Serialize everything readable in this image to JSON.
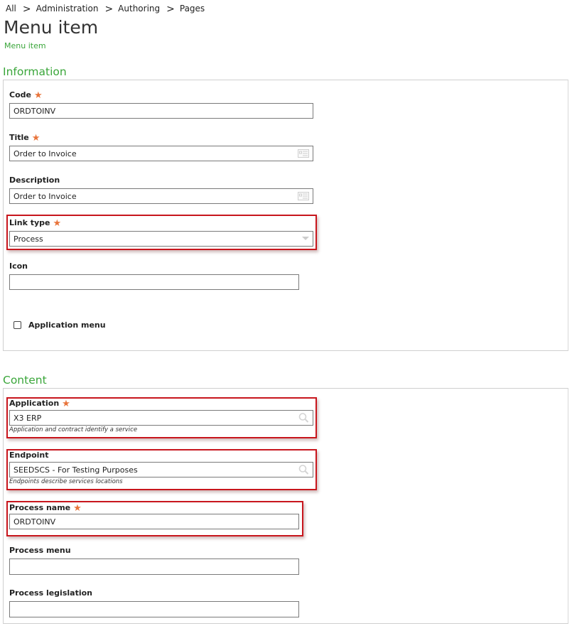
{
  "breadcrumb": {
    "items": [
      "All",
      "Administration",
      "Authoring",
      "Pages"
    ],
    "separator": ">"
  },
  "page": {
    "title": "Menu item",
    "subtitle": "Menu item"
  },
  "colors": {
    "accent_green": "#3aa63a",
    "required_star": "#e8743b",
    "highlight_red": "#c8161d"
  },
  "sections": {
    "information": {
      "title": "Information",
      "fields": {
        "code": {
          "label": "Code",
          "required": true,
          "value": "ORDTOINV"
        },
        "title": {
          "label": "Title",
          "required": true,
          "value": "Order to Invoice",
          "icon": "translate-icon"
        },
        "description": {
          "label": "Description",
          "required": false,
          "value": "Order to Invoice",
          "icon": "translate-icon"
        },
        "link_type": {
          "label": "Link type",
          "required": true,
          "value": "Process",
          "icon": "dropdown-arrow-icon"
        },
        "icon": {
          "label": "Icon",
          "required": false,
          "value": ""
        },
        "application_menu": {
          "label": "Application menu",
          "checked": false
        }
      }
    },
    "content": {
      "title": "Content",
      "fields": {
        "application": {
          "label": "Application",
          "required": true,
          "value": "X3 ERP",
          "hint": "Application and contract identify a service",
          "icon": "search-icon"
        },
        "endpoint": {
          "label": "Endpoint",
          "required": false,
          "value": "SEEDSCS - For Testing Purposes",
          "hint": "Endpoints describe services locations",
          "icon": "search-icon"
        },
        "process_name": {
          "label": "Process name",
          "required": true,
          "value": "ORDTOINV"
        },
        "process_menu": {
          "label": "Process menu",
          "required": false,
          "value": ""
        },
        "process_legislation": {
          "label": "Process legislation",
          "required": false,
          "value": ""
        }
      }
    }
  },
  "required_marker": "★"
}
